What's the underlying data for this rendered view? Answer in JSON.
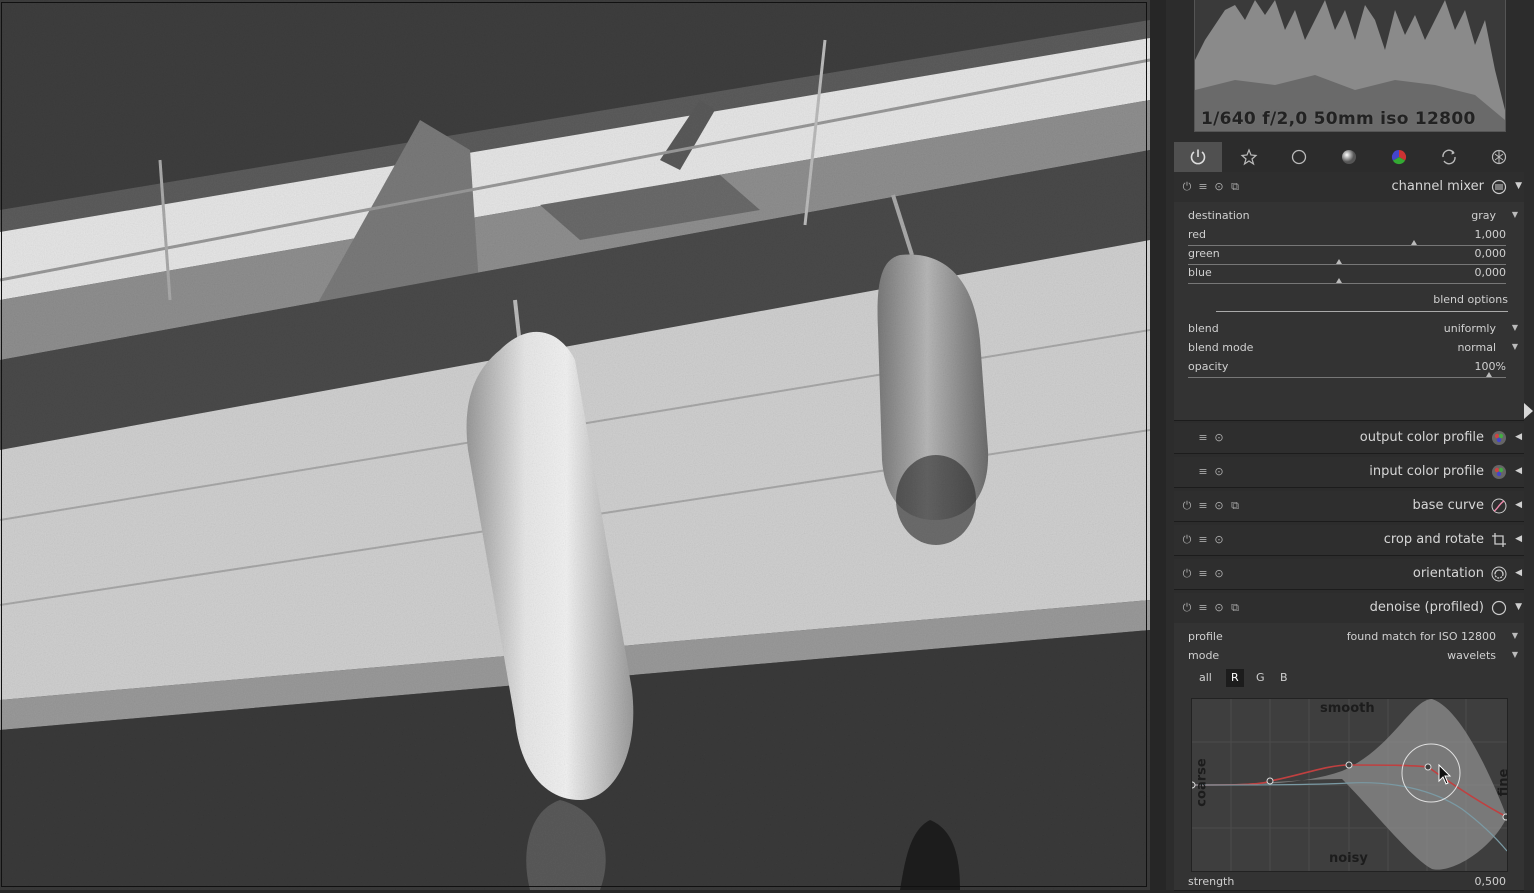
{
  "histogram": {
    "exif_info": "1/640 f/2,0 50mm iso 12800"
  },
  "module_groups": [
    {
      "icon": "power-icon",
      "active": true
    },
    {
      "icon": "star-icon"
    },
    {
      "icon": "circle-icon"
    },
    {
      "icon": "tone-sphere-icon"
    },
    {
      "icon": "color-sphere-icon"
    },
    {
      "icon": "correct-icon"
    },
    {
      "icon": "effect-icon"
    }
  ],
  "channel_mixer": {
    "name": "channel mixer",
    "params": {
      "destination": {
        "label": "destination",
        "value": "gray"
      },
      "red": {
        "label": "red",
        "value": "1,000",
        "level": 1.0
      },
      "green": {
        "label": "green",
        "value": "0,000",
        "level": 0.0
      },
      "blue": {
        "label": "blue",
        "value": "0,000",
        "level": 0.0
      }
    },
    "blend_options_label": "blend options",
    "blend": {
      "label": "blend",
      "value": "uniformly"
    },
    "blend_mode": {
      "label": "blend mode",
      "value": "normal"
    },
    "opacity": {
      "label": "opacity",
      "value": "100%",
      "level": 1.0
    }
  },
  "modules": [
    {
      "name": "output color profile",
      "icon": "color-profile-icon"
    },
    {
      "name": "input color profile",
      "icon": "color-profile-icon"
    },
    {
      "name": "base curve",
      "icon": "curve-icon"
    },
    {
      "name": "crop and rotate",
      "icon": "crop-icon"
    },
    {
      "name": "orientation",
      "icon": "rotate-icon"
    }
  ],
  "denoise": {
    "name": "denoise (profiled)",
    "profile": {
      "label": "profile",
      "value": "found match for ISO 12800"
    },
    "mode": {
      "label": "mode",
      "value": "wavelets"
    },
    "channel_tabs": [
      "all",
      "R",
      "G",
      "B"
    ],
    "active_tab": "R",
    "graph_labels": {
      "top": "smooth",
      "bottom": "noisy",
      "left": "coarse",
      "right": "fine"
    },
    "strength": {
      "label": "strength",
      "value": "0,500"
    }
  }
}
